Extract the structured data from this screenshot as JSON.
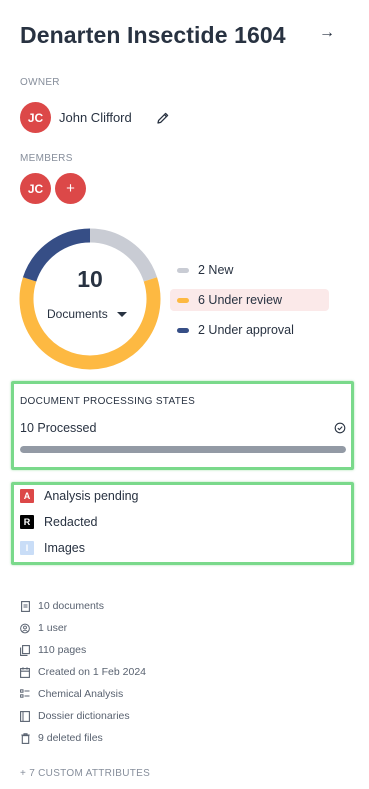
{
  "header": {
    "title": "Denarten Insectide 1604",
    "open_icon": "arrow-right-icon"
  },
  "owner": {
    "label": "OWNER",
    "initials": "JC",
    "name": "John Clifford",
    "edit_icon": "pencil-icon"
  },
  "members": {
    "label": "MEMBERS",
    "avatars": [
      {
        "initials": "JC"
      }
    ],
    "add_label": "+"
  },
  "documents_chart": {
    "count": "10",
    "selector_label": "Documents",
    "colors": {
      "new": "#c9ccd4",
      "under_review": "#fdb942",
      "under_approval": "#364e86"
    },
    "active_legend": "Under review"
  },
  "chart_data": {
    "type": "pie",
    "variant": "donut",
    "center_value": 10,
    "series": [
      {
        "name": "New",
        "value": 2,
        "color": "#c9ccd4"
      },
      {
        "name": "Under review",
        "value": 6,
        "color": "#fdb942"
      },
      {
        "name": "Under approval",
        "value": 2,
        "color": "#364e86"
      }
    ],
    "legend_labels": [
      "2 New",
      "6 Under review",
      "2 Under approval"
    ],
    "legend_placement": "right"
  },
  "processing_states": {
    "title": "DOCUMENT PROCESSING STATES",
    "processed_label": "10 Processed",
    "processed_icon": "check-circle-icon",
    "progress_fraction": 1.0
  },
  "document_types": [
    {
      "badge": "A",
      "label": "Analysis pending",
      "color": "#dc4848"
    },
    {
      "badge": "R",
      "label": "Redacted",
      "color": "#000000"
    },
    {
      "badge": "I",
      "label": "Images",
      "color": "#c9ddf7"
    }
  ],
  "stats": [
    {
      "icon": "document-icon",
      "text": "10 documents"
    },
    {
      "icon": "user-circle-icon",
      "text": "1 user"
    },
    {
      "icon": "pages-icon",
      "text": "110 pages"
    },
    {
      "icon": "calendar-icon",
      "text": "Created on 1 Feb 2024"
    },
    {
      "icon": "list-icon",
      "text": "Chemical Analysis"
    },
    {
      "icon": "dictionary-icon",
      "text": "Dossier dictionaries"
    },
    {
      "icon": "trash-icon",
      "text": "9 deleted files"
    }
  ],
  "custom_attributes_label": "+ 7 CUSTOM ATTRIBUTES"
}
